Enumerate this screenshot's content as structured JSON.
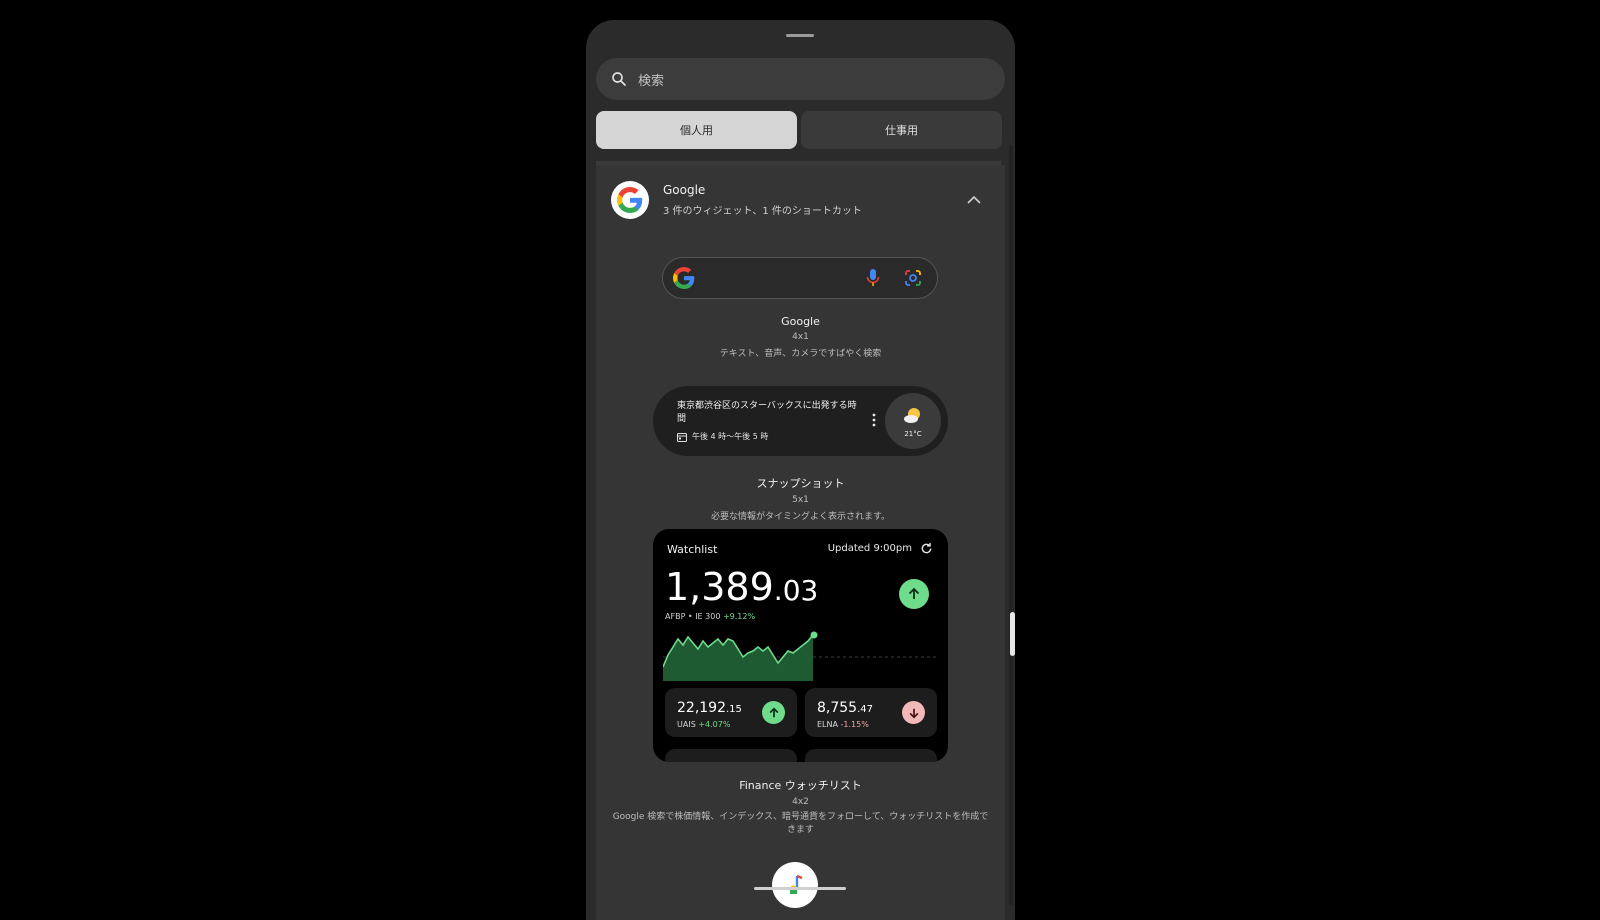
{
  "search": {
    "placeholder": "検索"
  },
  "tabs": {
    "personal": "個人用",
    "work": "仕事用"
  },
  "app": {
    "name": "Google",
    "subtitle": "3 件のウィジェット、1 件のショートカット"
  },
  "widgets": [
    {
      "title": "Google",
      "size": "4x1",
      "description": "テキスト、音声、カメラですばやく検索"
    },
    {
      "title": "スナップショット",
      "size": "5x1",
      "description": "必要な情報がタイミングよく表示されます。"
    },
    {
      "title": "Finance ウォッチリスト",
      "size": "4x2",
      "description": "Google 検索で株価情報、インデックス、暗号通貨をフォローして、ウォッチリストを作成できます"
    }
  ],
  "snapshot": {
    "text": "東京都渋谷区のスターバックスに出発する時間",
    "time": "午後 4 時〜午後 5 時",
    "temp": "21°C"
  },
  "watchlist": {
    "title": "Watchlist",
    "updated": "Updated 9:00pm",
    "big_int": "1,389",
    "big_dec": ".03",
    "symbol": "AFBP • IE 300",
    "change": "+9.12%",
    "cards": [
      {
        "int": "22,192",
        "frac": ".15",
        "symbol": "UAIS",
        "change": "+4.07%",
        "direction": "up"
      },
      {
        "int": "8,755",
        "frac": ".47",
        "symbol": "ELNA",
        "change": "-1.15%",
        "direction": "down"
      }
    ]
  },
  "colors": {
    "positive": "#6fdc8c",
    "negative": "#f3b8b8",
    "background": "#000000",
    "sheet": "#2b2b2b"
  }
}
